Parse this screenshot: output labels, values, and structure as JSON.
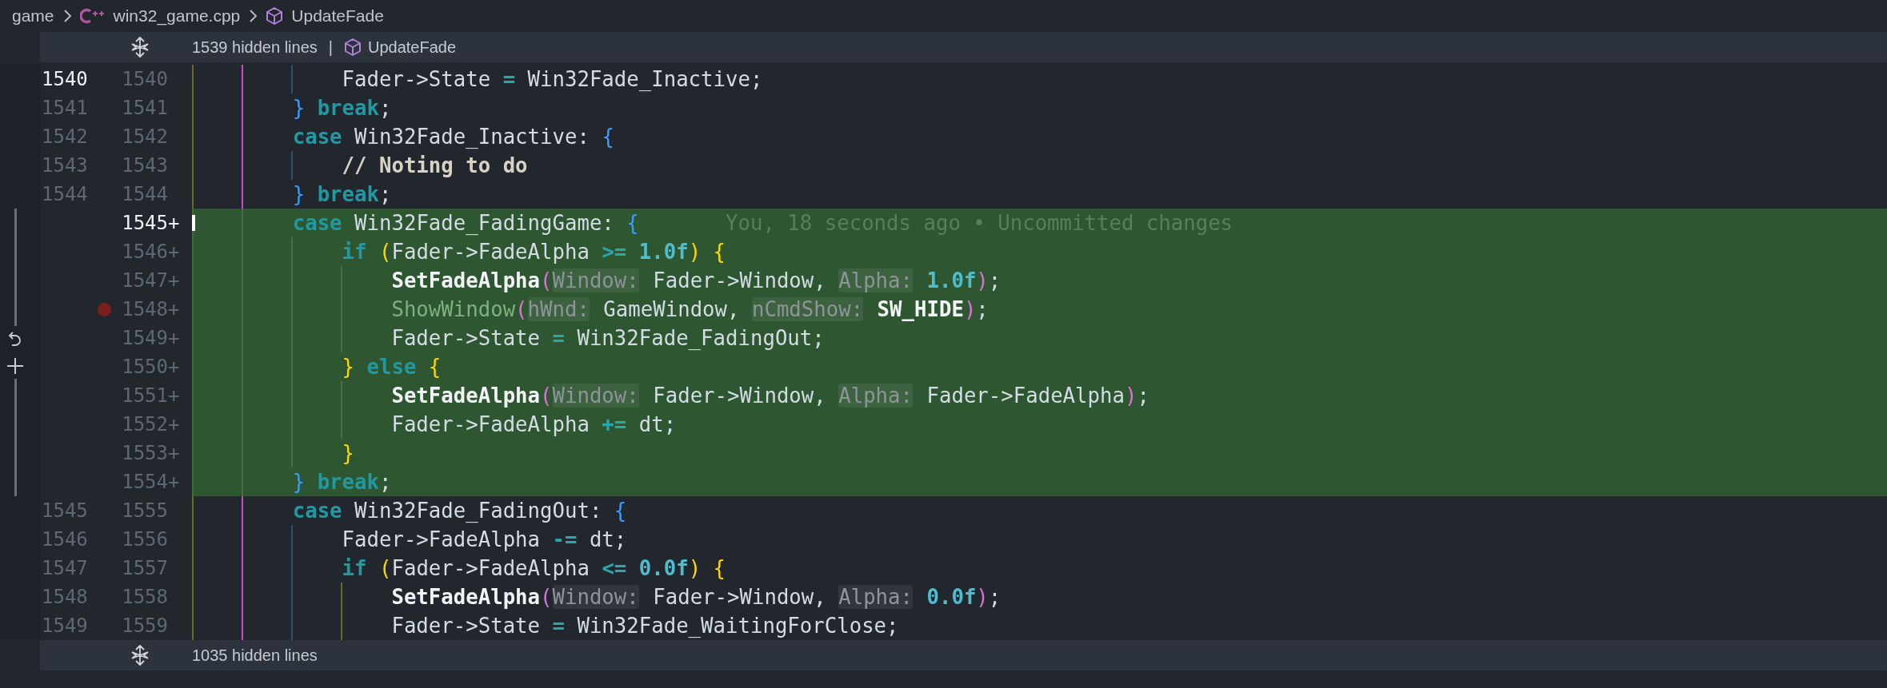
{
  "breadcrumbs": [
    {
      "kind": "folder",
      "label": "game"
    },
    {
      "kind": "file",
      "label": "win32_game.cpp"
    },
    {
      "kind": "symbol",
      "label": "UpdateFade"
    }
  ],
  "hidden_top": {
    "label": "1539 hidden lines",
    "separator": "|",
    "symbol": "UpdateFade"
  },
  "lines": [
    {
      "old": "1540",
      "new": "1540",
      "added": false,
      "active_old": true,
      "active_new": false,
      "breakpoint": false,
      "tokens": [
        {
          "kind": "id",
          "text": "            Fader->State "
        },
        {
          "kind": "op",
          "text": "="
        },
        {
          "kind": "id",
          "text": " Win32Fade_Inactive;"
        }
      ]
    },
    {
      "old": "1541",
      "new": "1541",
      "added": false,
      "active_old": false,
      "active_new": false,
      "breakpoint": false,
      "tokens": [
        {
          "kind": "brace1",
          "text": "        }"
        },
        {
          "kind": "kw",
          "text": " break"
        },
        {
          "kind": "id",
          "text": ";"
        }
      ]
    },
    {
      "old": "1542",
      "new": "1542",
      "added": false,
      "active_old": false,
      "active_new": false,
      "breakpoint": false,
      "tokens": [
        {
          "kind": "kw",
          "text": "        case"
        },
        {
          "kind": "id",
          "text": " Win32Fade_Inactive: "
        },
        {
          "kind": "brace1",
          "text": "{"
        }
      ]
    },
    {
      "old": "1543",
      "new": "1543",
      "added": false,
      "active_old": false,
      "active_new": false,
      "breakpoint": false,
      "tokens": [
        {
          "kind": "comment",
          "text": "            // Noting to do"
        }
      ]
    },
    {
      "old": "1544",
      "new": "1544",
      "added": false,
      "active_old": false,
      "active_new": false,
      "breakpoint": false,
      "tokens": [
        {
          "kind": "brace1",
          "text": "        }"
        },
        {
          "kind": "kw",
          "text": " break"
        },
        {
          "kind": "id",
          "text": ";"
        }
      ]
    },
    {
      "new": "1545",
      "marker": "+",
      "added": true,
      "active_new": true,
      "breakpoint": false,
      "blame": "You, 18 seconds ago • Uncommitted changes",
      "tokens": [
        {
          "kind": "kw",
          "text": "        case"
        },
        {
          "kind": "id",
          "text": " Win32Fade_FadingGame: "
        },
        {
          "kind": "brace1",
          "text": "{"
        }
      ]
    },
    {
      "new": "1546",
      "marker": "+",
      "added": true,
      "active_new": false,
      "breakpoint": false,
      "tokens": [
        {
          "kind": "kw",
          "text": "            if"
        },
        {
          "kind": "brace2",
          "text": " ("
        },
        {
          "kind": "id",
          "text": "Fader->FadeAlpha "
        },
        {
          "kind": "op",
          "text": ">="
        },
        {
          "kind": "num",
          "text": " 1.0f"
        },
        {
          "kind": "brace2",
          "text": ")"
        },
        {
          "kind": "brace2",
          "text": " {"
        }
      ]
    },
    {
      "new": "1547",
      "marker": "+",
      "added": true,
      "active_new": false,
      "breakpoint": false,
      "tokens": [
        {
          "kind": "fn",
          "text": "                SetFadeAlpha"
        },
        {
          "kind": "paren",
          "text": "("
        },
        {
          "kind": "hint",
          "text": "Window:"
        },
        {
          "kind": "id",
          "text": " Fader->Window, "
        },
        {
          "kind": "hint",
          "text": "Alpha:"
        },
        {
          "kind": "num",
          "text": " 1.0f"
        },
        {
          "kind": "paren",
          "text": ")"
        },
        {
          "kind": "id",
          "text": ";"
        }
      ]
    },
    {
      "new": "1548",
      "marker": "+",
      "added": true,
      "active_new": false,
      "breakpoint": true,
      "tokens": [
        {
          "kind": "fndim",
          "text": "                ShowWindow"
        },
        {
          "kind": "paren",
          "text": "("
        },
        {
          "kind": "hint",
          "text": "hWnd:"
        },
        {
          "kind": "id",
          "text": " GameWindow, "
        },
        {
          "kind": "hint",
          "text": "nCmdShow:"
        },
        {
          "kind": "const",
          "text": " SW_HIDE"
        },
        {
          "kind": "paren",
          "text": ")"
        },
        {
          "kind": "id",
          "text": ";"
        }
      ]
    },
    {
      "new": "1549",
      "marker": "+",
      "added": true,
      "active_new": false,
      "breakpoint": false,
      "tokens": [
        {
          "kind": "id",
          "text": "                Fader->State "
        },
        {
          "kind": "op",
          "text": "="
        },
        {
          "kind": "id",
          "text": " Win32Fade_FadingOut;"
        }
      ]
    },
    {
      "new": "1550",
      "marker": "+",
      "added": true,
      "active_new": false,
      "breakpoint": false,
      "tokens": [
        {
          "kind": "brace2",
          "text": "            }"
        },
        {
          "kind": "kw",
          "text": " else"
        },
        {
          "kind": "brace2",
          "text": " {"
        }
      ]
    },
    {
      "new": "1551",
      "marker": "+",
      "added": true,
      "active_new": false,
      "breakpoint": false,
      "tokens": [
        {
          "kind": "fn",
          "text": "                SetFadeAlpha"
        },
        {
          "kind": "paren",
          "text": "("
        },
        {
          "kind": "hint",
          "text": "Window:"
        },
        {
          "kind": "id",
          "text": " Fader->Window, "
        },
        {
          "kind": "hint",
          "text": "Alpha:"
        },
        {
          "kind": "id",
          "text": " Fader->FadeAlpha"
        },
        {
          "kind": "paren",
          "text": ")"
        },
        {
          "kind": "id",
          "text": ";"
        }
      ]
    },
    {
      "new": "1552",
      "marker": "+",
      "added": true,
      "active_new": false,
      "breakpoint": false,
      "tokens": [
        {
          "kind": "id",
          "text": "                Fader->FadeAlpha "
        },
        {
          "kind": "op",
          "text": "+="
        },
        {
          "kind": "id",
          "text": " dt;"
        }
      ]
    },
    {
      "new": "1553",
      "marker": "+",
      "added": true,
      "active_new": false,
      "breakpoint": false,
      "tokens": [
        {
          "kind": "brace2",
          "text": "            }"
        }
      ]
    },
    {
      "new": "1554",
      "marker": "+",
      "added": true,
      "active_new": false,
      "breakpoint": false,
      "tokens": [
        {
          "kind": "brace1",
          "text": "        }"
        },
        {
          "kind": "kw",
          "text": " break"
        },
        {
          "kind": "id",
          "text": ";"
        }
      ]
    },
    {
      "old": "1545",
      "new": "1555",
      "added": false,
      "active_old": false,
      "active_new": false,
      "breakpoint": false,
      "tokens": [
        {
          "kind": "kw",
          "text": "        case"
        },
        {
          "kind": "id",
          "text": " Win32Fade_FadingOut: "
        },
        {
          "kind": "brace1",
          "text": "{"
        }
      ]
    },
    {
      "old": "1546",
      "new": "1556",
      "added": false,
      "active_old": false,
      "active_new": false,
      "breakpoint": false,
      "tokens": [
        {
          "kind": "id",
          "text": "            Fader->FadeAlpha "
        },
        {
          "kind": "op",
          "text": "-="
        },
        {
          "kind": "id",
          "text": " dt;"
        }
      ]
    },
    {
      "old": "1547",
      "new": "1557",
      "added": false,
      "active_old": false,
      "active_new": false,
      "breakpoint": false,
      "tokens": [
        {
          "kind": "kw",
          "text": "            if"
        },
        {
          "kind": "brace2",
          "text": " ("
        },
        {
          "kind": "id",
          "text": "Fader->FadeAlpha "
        },
        {
          "kind": "op",
          "text": "<="
        },
        {
          "kind": "num",
          "text": " 0.0f"
        },
        {
          "kind": "brace2",
          "text": ")"
        },
        {
          "kind": "brace2",
          "text": " {"
        }
      ]
    },
    {
      "old": "1548",
      "new": "1558",
      "added": false,
      "active_old": false,
      "active_new": false,
      "breakpoint": false,
      "tokens": [
        {
          "kind": "fn",
          "text": "                SetFadeAlpha"
        },
        {
          "kind": "paren",
          "text": "("
        },
        {
          "kind": "hint",
          "text": "Window:"
        },
        {
          "kind": "id",
          "text": " Fader->Window, "
        },
        {
          "kind": "hint",
          "text": "Alpha:"
        },
        {
          "kind": "num",
          "text": " 0.0f"
        },
        {
          "kind": "paren",
          "text": ")"
        },
        {
          "kind": "id",
          "text": ";"
        }
      ]
    },
    {
      "old": "1549",
      "new": "1559",
      "added": false,
      "active_old": false,
      "active_new": false,
      "breakpoint": false,
      "tokens": [
        {
          "kind": "id",
          "text": "                Fader->State "
        },
        {
          "kind": "op",
          "text": "="
        },
        {
          "kind": "id",
          "text": " Win32Fade_WaitingForClose;"
        }
      ]
    }
  ],
  "hidden_bottom": {
    "label": "1035 hidden lines"
  }
}
